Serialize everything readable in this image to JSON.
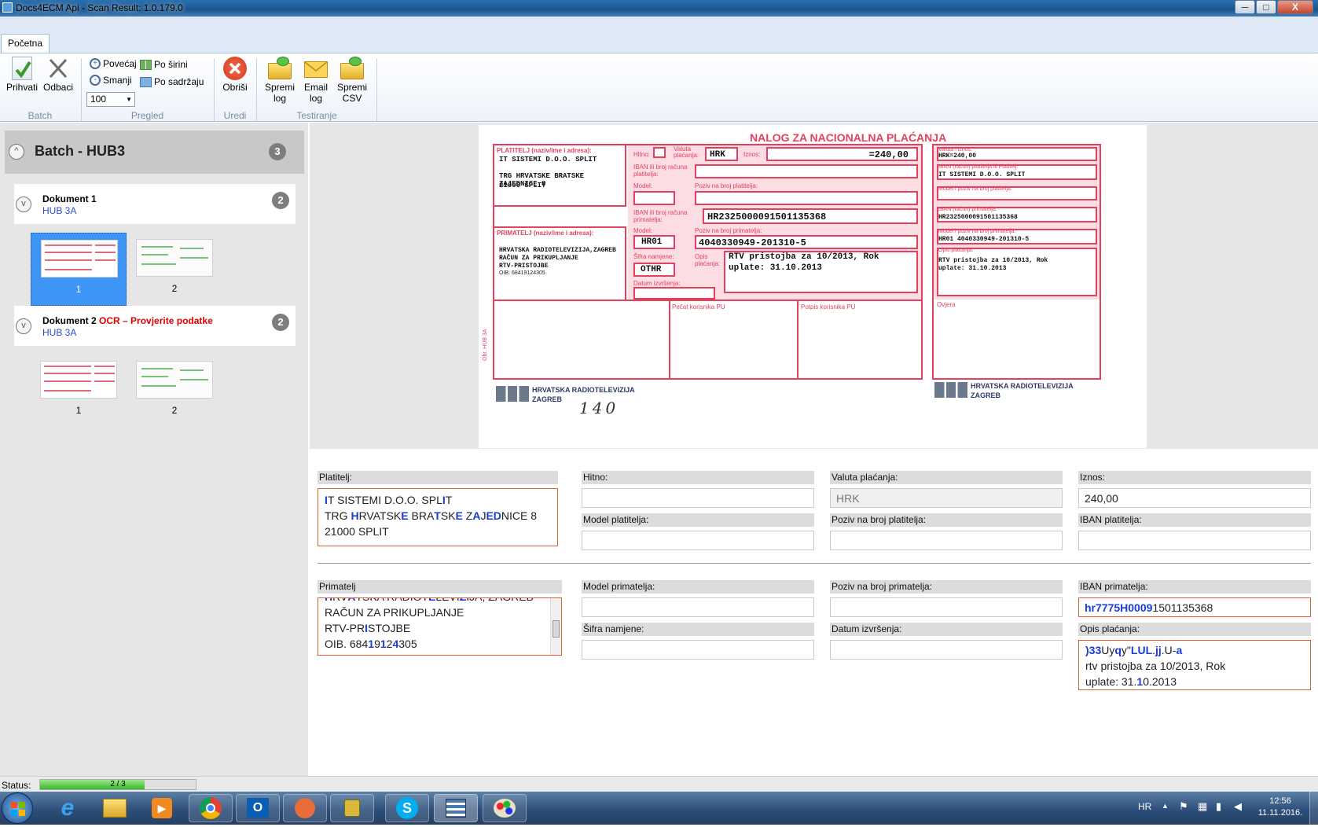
{
  "window": {
    "title": "Docs4ECM Api - Scan Result: 1.0.179.0",
    "min_label": "─",
    "max_label": "□",
    "close_label": "X"
  },
  "ribbon": {
    "tab": "Početna",
    "buttons": {
      "prihvati": "Prihvati",
      "odbaci": "Odbaci",
      "povecaj": "Povećaj",
      "smanji": "Smanji",
      "po_sirini": "Po širini",
      "po_sadrzaju": "Po sadržaju",
      "zoom_value": "100",
      "obrisi": "Obriši",
      "spremi_log_1": "Spremi",
      "spremi_log_2": "log",
      "email_log_1": "Email",
      "email_log_2": "log",
      "spremi_csv_1": "Spremi",
      "spremi_csv_2": "CSV"
    },
    "groups": {
      "batch": "Batch",
      "pregled": "Pregled",
      "uredi": "Uredi",
      "testiranje": "Testiranje"
    }
  },
  "batch": {
    "title": "Batch - HUB3",
    "count": "3",
    "collapse_symbol": "^",
    "documents": [
      {
        "name": "Dokument 1",
        "warning": "",
        "subtitle": "HUB 3A",
        "count": "2",
        "expand_symbol": "v",
        "pages": [
          "1",
          "2"
        ]
      },
      {
        "name": "Dokument 2",
        "warning": "OCR – Provjerite podatke",
        "subtitle": "HUB 3A",
        "count": "2",
        "expand_symbol": "v",
        "pages": [
          "1",
          "2"
        ]
      }
    ]
  },
  "scan": {
    "title": "NALOG ZA NACIONALNA PLAĆANJA",
    "platitelj_label": "PLATITELJ (naziv/ime i adresa):",
    "platitelj_l1": "IT SISTEMI D.O.O.  SPLIT",
    "platitelj_l2": "TRG HRVATSKE BRATSKE ZAJEDNICE 8",
    "platitelj_l3": "21000 SPLIT",
    "hitno": "Hitno:",
    "valuta_label": "Valuta plaćanja:",
    "valuta": "HRK",
    "iznos_label": "Iznos:",
    "iznos": "=240,00",
    "iban_plat_label": "IBAN ili broj računa platitelja:",
    "model_label": "Model:",
    "poziv_plat_label": "Poziv na broj platitelja:",
    "iban_prim_label": "IBAN ili broj računa primatelja:",
    "iban_prim": "HR2325000091501135368",
    "primatelj_label": "PRIMATELJ (naziv/ime i adresa):",
    "primatelj_l1": "HRVATSKA RADIOTELEVIZIJA,ZAGREB",
    "primatelj_l2": "RAČUN ZA PRIKUPLJANJE",
    "primatelj_l3": "RTV-PRISTOJBE",
    "primatelj_l4": "OIB: 68419124305",
    "model_prim_label": "Model:",
    "poziv_prim_label": "Poziv na broj primatelja:",
    "model_prim": "HR01",
    "poziv_prim": "4040330949-201310-5",
    "sifra_label": "Šifra namjene:",
    "sifra": "OTHR",
    "opis_label": "Opis plaćanja:",
    "opis_l1": "RTV pristojba za 10/2013, Rok",
    "opis_l2": "uplate: 31.10.2013",
    "datum_label": "Datum izvršenja:",
    "pecat": "Pečat korisnika PU",
    "potpis": "Potpis korisnika PU",
    "obr": "Obr. HUB 3A",
    "logo1": "HRVATSKA RADIOTELEVIZIJA",
    "logo2": "ZAGREB",
    "handwritten": "140",
    "r_valuta_label": "Valuta i iznos:",
    "r_valuta": "HRK=240,00",
    "r_iban_plat_label": "IBAN (račun) platitelja ili Platitelj:",
    "r_iban_plat": "IT SISTEMI D.O.O.  SPLIT",
    "r_model_plat_label": "Model i poziv na broj platitelja:",
    "r_iban_prim_label": "IBAN (račun) primatelja:",
    "r_iban_prim": "HR2325000091501135368",
    "r_model_prim_label": "Model i poziv na broj primatelja:",
    "r_model_prim": "HR01 4040330949-201310-5",
    "r_opis_label": "Opis plaćanja:",
    "r_opis_l1": "RTV pristojba za 10/2013, Rok",
    "r_opis_l2": "uplate: 31.10.2013",
    "r_ovjera": "Ovjera"
  },
  "form": {
    "platitelj_label": "Platitelj:",
    "hitno_label": "Hitno:",
    "valuta_label": "Valuta plaćanja:",
    "valuta_value": "HRK",
    "iznos_label": "Iznos:",
    "iznos_value": "240,00",
    "model_plat_label": "Model platitelja:",
    "poziv_plat_label": "Poziv na broj platitelja:",
    "iban_plat_label": "IBAN platitelja:",
    "primatelj_label": "Primatelj",
    "model_prim_label": "Model primatelja:",
    "poziv_prim_label": "Poziv na broj primatelja:",
    "iban_prim_label": "IBAN primatelja:",
    "sifra_label": "Šifra namjene:",
    "datum_label": "Datum izvršenja:",
    "opis_label": "Opis plaćanja:"
  },
  "status": {
    "label": "Status:",
    "progress_text": "2 / 3",
    "progress": 0.67
  },
  "taskbar": {
    "lang": "HR",
    "time": "12:56",
    "date": "11.11.2016."
  },
  "colors": {
    "accent": "#2a4bd1",
    "warning": "#e00000",
    "error_border": "#e06030",
    "scan_pink": "#e5415e",
    "selected_thumb": "#3d95f5"
  }
}
